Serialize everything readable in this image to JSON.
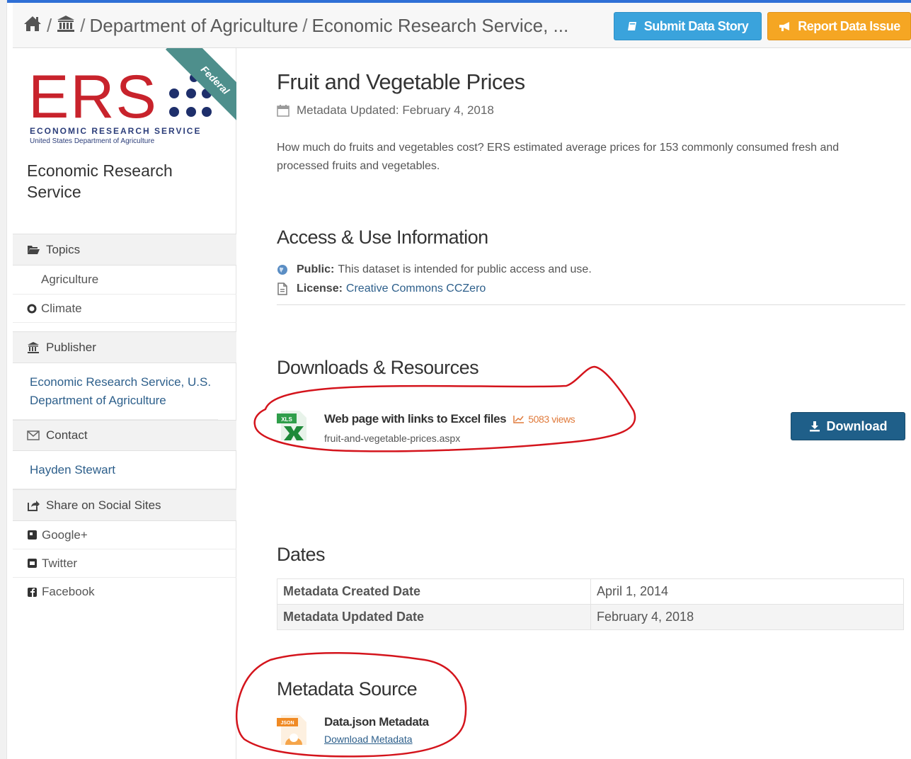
{
  "header": {
    "breadcrumb": [
      "Department of Agriculture",
      "Economic Research Service, ..."
    ],
    "submit_label": "Submit Data Story",
    "report_label": "Report Data Issue"
  },
  "sidebar": {
    "logo_letters": "ERS",
    "logo_line1": "ECONOMIC RESEARCH SERVICE",
    "logo_line2": "United States Department of Agriculture",
    "ribbon": "Federal",
    "org_name": "Economic Research Service",
    "topics_label": "Topics",
    "topics": [
      "Agriculture",
      "Climate"
    ],
    "publisher_label": "Publisher",
    "publisher": "Economic Research Service, U.S. Department of Agriculture",
    "contact_label": "Contact",
    "contact": "Hayden Stewart",
    "share_label": "Share on Social Sites",
    "social": [
      "Google+",
      "Twitter",
      "Facebook"
    ]
  },
  "main": {
    "title": "Fruit and Vegetable Prices",
    "metadata_updated": "Metadata Updated: February 4, 2018",
    "description": "How much do fruits and vegetables cost? ERS estimated average prices for 153 commonly consumed fresh and processed fruits and vegetables.",
    "access_heading": "Access & Use Information",
    "public_label": "Public:",
    "public_text": "This dataset is intended for public access and use.",
    "license_label": "License:",
    "license_text": "Creative Commons CCZero",
    "downloads_heading": "Downloads & Resources",
    "resource": {
      "icon_label": "XLS",
      "name": "Web page with links to Excel files",
      "views": "5083 views",
      "file": "fruit-and-vegetable-prices.aspx",
      "download_label": "Download"
    },
    "dates_heading": "Dates",
    "dates": [
      {
        "key": "Metadata Created Date",
        "value": "April 1, 2014"
      },
      {
        "key": "Metadata Updated Date",
        "value": "February 4, 2018"
      }
    ],
    "metadata_source_heading": "Metadata Source",
    "metadata_source": {
      "icon_label": "JSON",
      "name": "Data.json Metadata",
      "link": "Download Metadata"
    }
  },
  "colors": {
    "accent_blue": "#3aa3dc",
    "accent_orange": "#f5a623",
    "ers_red": "#c8232c",
    "download_blue": "#1f5f89",
    "annotation_red": "#d4141c"
  }
}
